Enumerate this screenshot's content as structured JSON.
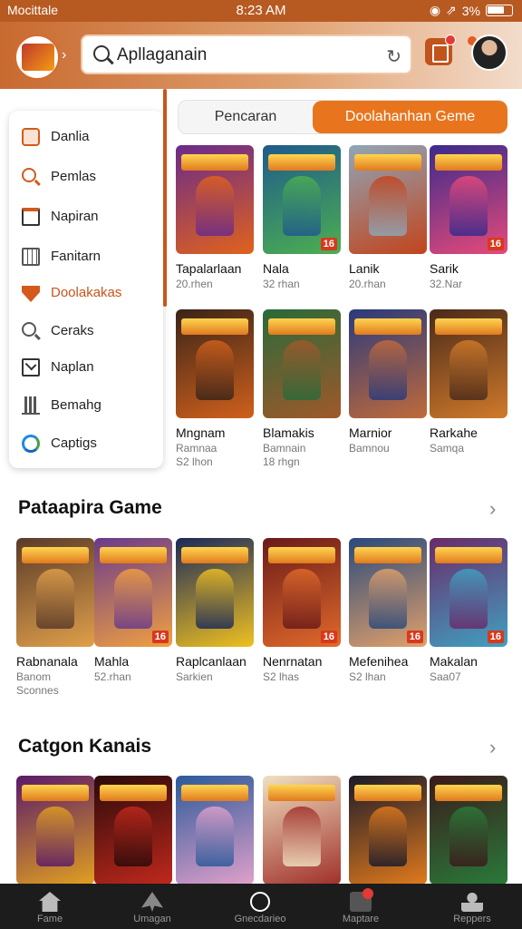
{
  "status_bar": {
    "carrier": "Mocittale",
    "time": "8:23 AM",
    "battery": "3%"
  },
  "header": {
    "search": {
      "value": "Apllaganain",
      "placeholder": "Apllaganain"
    }
  },
  "sidebar": {
    "items": [
      {
        "label": "Danlia",
        "icon": "folder-icon"
      },
      {
        "label": "Pemlas",
        "icon": "search-icon"
      },
      {
        "label": "Napiran",
        "icon": "frame-icon"
      },
      {
        "label": "Fanitarn",
        "icon": "calendar-icon"
      },
      {
        "label": "Doolakakas",
        "icon": "shield-icon"
      },
      {
        "label": "Ceraks",
        "icon": "search-icon"
      },
      {
        "label": "Naplan",
        "icon": "mail-icon"
      },
      {
        "label": "Bemahg",
        "icon": "chart-icon"
      },
      {
        "label": "Captigs",
        "icon": "circle-icon"
      }
    ]
  },
  "tabs": [
    {
      "label": "Pencaran"
    },
    {
      "label": "Doolahanhan Geme"
    }
  ],
  "top_grid": [
    {
      "name": "Tapalarlaan",
      "sub": "20.rhen",
      "badge": "",
      "colors": [
        "#6a2a8c",
        "#e0621c"
      ]
    },
    {
      "name": "Nala",
      "sub": "32 rhan",
      "badge": "16",
      "colors": [
        "#1f5a8c",
        "#4caf50"
      ]
    },
    {
      "name": "Lanik",
      "sub": "20.rhan",
      "badge": "",
      "colors": [
        "#8fa6b8",
        "#c2441c"
      ]
    },
    {
      "name": "Sarik",
      "sub": "32.Nar",
      "badge": "16",
      "colors": [
        "#3a2a8c",
        "#e64a7a"
      ]
    },
    {
      "name": "Mngnam",
      "sub": "Ramnaa",
      "sub2": "S2 lhon",
      "badge": "",
      "colors": [
        "#3a2418",
        "#d0601c"
      ]
    },
    {
      "name": "Blamakis",
      "sub": "Bamnain",
      "sub2": "18 rhgn",
      "badge": "",
      "colors": [
        "#2a6a3a",
        "#a0582a"
      ]
    },
    {
      "name": "Marnior",
      "sub": "Bamnou",
      "badge": "",
      "colors": [
        "#2a3a7c",
        "#c06a3a"
      ]
    },
    {
      "name": "Rarkahe",
      "sub": "Samqa",
      "badge": "",
      "colors": [
        "#4a2a1a",
        "#d07a2a"
      ]
    }
  ],
  "section1": {
    "title": "Pataapira Game",
    "games": [
      {
        "name": "Rabnanala",
        "sub": "Banom",
        "sub2": "Sconnes",
        "badge": "",
        "colors": [
          "#5a3a2a",
          "#e0a04a"
        ]
      },
      {
        "name": "Mahla",
        "sub": "52.rhan",
        "badge": "16",
        "colors": [
          "#6a3a8c",
          "#f0a040"
        ]
      },
      {
        "name": "Raplcanlaan",
        "sub": "Sarkien",
        "badge": "",
        "colors": [
          "#1a2a5a",
          "#f0c020"
        ]
      },
      {
        "name": "Nenrnatan",
        "sub": "S2 lhas",
        "badge": "16",
        "colors": [
          "#6a1a1a",
          "#e06a2a"
        ]
      },
      {
        "name": "Mefenihea",
        "sub": "S2 lhan",
        "badge": "16",
        "colors": [
          "#2a4a7c",
          "#e0a06a"
        ]
      },
      {
        "name": "Makalan",
        "sub": "Saa07",
        "badge": "16",
        "colors": [
          "#6a2a6a",
          "#40a0c0"
        ]
      }
    ]
  },
  "section2": {
    "title": "Catgon Kanais",
    "games": [
      {
        "colors": [
          "#5a1a6a",
          "#e0a020"
        ]
      },
      {
        "colors": [
          "#2a0a0a",
          "#c0281c"
        ]
      },
      {
        "colors": [
          "#2a5a9a",
          "#e0a0ca"
        ]
      },
      {
        "colors": [
          "#f0e0c0",
          "#a0302a"
        ]
      },
      {
        "colors": [
          "#1a1a2a",
          "#e07a1c"
        ]
      },
      {
        "colors": [
          "#3a1a1a",
          "#2a7a3a"
        ]
      }
    ]
  },
  "bottom_nav": [
    {
      "label": "Fame",
      "icon": "home-icon"
    },
    {
      "label": "Umagan",
      "icon": "rocket-icon"
    },
    {
      "label": "Gnecdarieo",
      "icon": "ring-icon"
    },
    {
      "label": "Maptare",
      "icon": "gift-icon"
    },
    {
      "label": "Reppers",
      "icon": "person-icon"
    }
  ],
  "colors": {
    "accent": "#e8751d",
    "header_start": "#c86a30",
    "nav_bg": "#1c1c1c"
  }
}
